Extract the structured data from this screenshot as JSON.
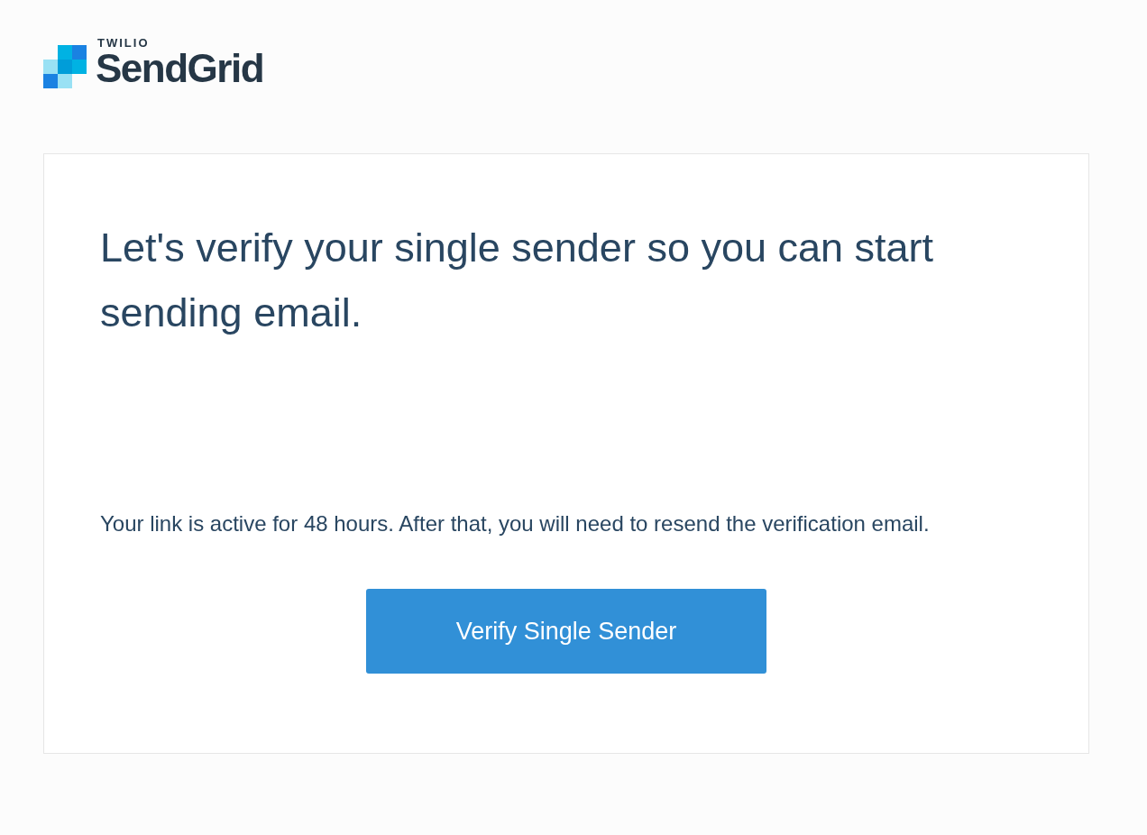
{
  "logo": {
    "brand_top": "TWILIO",
    "brand_name": "SendGrid"
  },
  "card": {
    "heading": "Let's verify your single sender so you can start sending email.",
    "note": "Your link is active for 48 hours. After that, you will need to resend the verification email.",
    "button": "Verify Single Sender"
  }
}
